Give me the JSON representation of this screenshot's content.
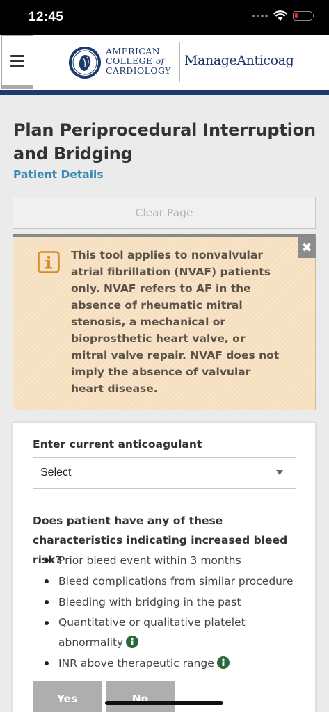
{
  "status_bar": {
    "time": "12:45"
  },
  "header": {
    "org_line1": "AMERICAN",
    "org_line2_a": "COLLEGE",
    "org_line2_of": "of",
    "org_line3": "CARDIOLOGY",
    "product_name": "ManageAnticoag",
    "icons": {
      "menu": "hamburger-menu-icon",
      "logo": "acc-seal-logo"
    },
    "colors": {
      "brand": "#1c3a6e"
    }
  },
  "page": {
    "title": "Plan Periprocedural Interruption and Bridging",
    "breadcrumb_link": "Patient Details",
    "clear_button": "Clear Page"
  },
  "notice": {
    "text": "This tool applies to nonvalvular atrial fibrillation (NVAF) patients only. NVAF refers to AF in the absence of rheumatic mitral stenosis, a mechanical or bioprosthetic heart valve, or mitral valve repair. NVAF does not imply the absence of valvular heart disease.",
    "icon": "info-square-icon",
    "close_icon": "close-icon",
    "colors": {
      "background": "#f5dfbe",
      "icon": "#d98a2a"
    }
  },
  "form": {
    "anticoag_label": "Enter current anticoagulant",
    "anticoag_value": "Select",
    "bleed_question": "Does patient have any of these characteristics indicating increased bleed risk?",
    "bleed_items": [
      "Prior bleed event within 3 months",
      "Bleed complications from similar procedure",
      "Bleeding with bridging in the past",
      "Quantitative or qualitative platelet abnormality",
      "INR above therapeutic range"
    ],
    "yes_label": "Yes",
    "no_label": "No",
    "info_icon_color": "#2a6a3a"
  }
}
